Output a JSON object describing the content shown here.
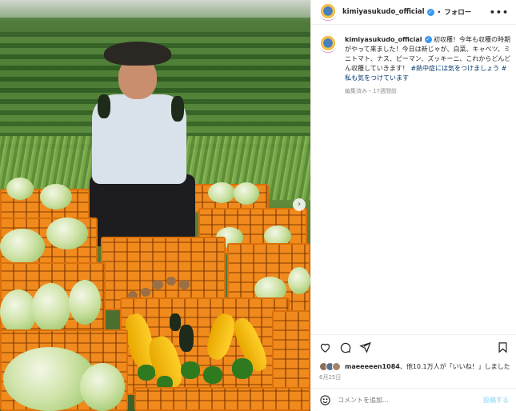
{
  "post": {
    "username": "kimiyasukudo_official",
    "separator": "•",
    "follow_label": "フォロー",
    "more_label": "•••",
    "next_label": "›"
  },
  "caption": {
    "username": "kimiyasukudo_official",
    "text": "初収穫！今年も収穫の時期がやって来ました！今日は新じゃが、白菜、キャベツ、ミニトマト、ナス、ピーマン、ズッキーニ、これからどんどん収穫していきます！",
    "hashtag_1": "#熱中症には気をつけましょう",
    "hashtag_2": "#私も気をつけています",
    "meta": "編集済み・17週間前"
  },
  "likes": {
    "user": "maeeeeen1084",
    "text": "、他10.1万人が「いいね！」しました"
  },
  "date": "6月25日",
  "comment": {
    "placeholder": "コメントを追加...",
    "post_label": "投稿する"
  },
  "icons": [
    "heart-icon",
    "comment-icon",
    "share-icon",
    "bookmark-icon",
    "smile-icon",
    "verified-icon"
  ],
  "colors": {
    "verified": "#3897f0",
    "hashtag": "#00376b",
    "muted": "#8e8e8e",
    "post_button": "#b2dffc",
    "crate": "#f08a1c"
  }
}
